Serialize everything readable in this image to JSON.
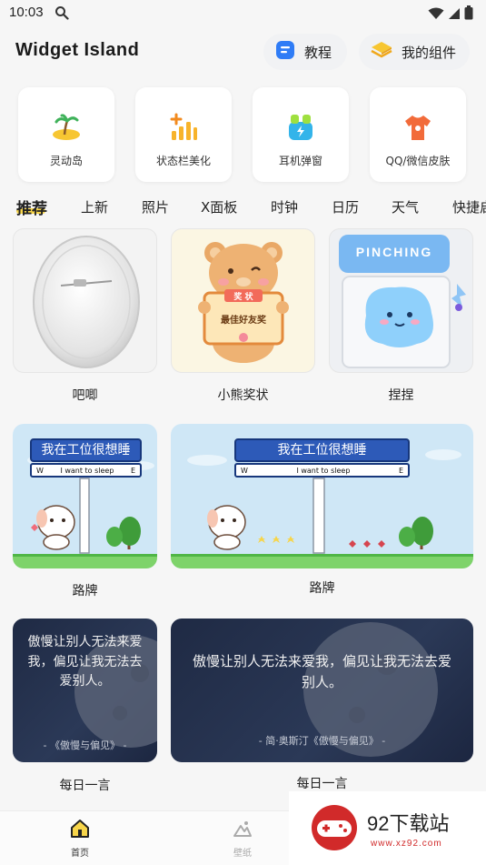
{
  "status": {
    "time": "10:03"
  },
  "header": {
    "title": "Widget Island",
    "tutorial_label": "教程",
    "my_widgets_label": "我的组件"
  },
  "features": [
    {
      "label": "灵动岛",
      "icon": "island-icon"
    },
    {
      "label": "状态栏美化",
      "icon": "signal-bars-icon"
    },
    {
      "label": "耳机弹窗",
      "icon": "earbuds-icon"
    },
    {
      "label": "QQ/微信皮肤",
      "icon": "tshirt-icon"
    }
  ],
  "tabs": [
    "推荐",
    "上新",
    "照片",
    "X面板",
    "时钟",
    "日历",
    "天气",
    "快捷启"
  ],
  "active_tab": "推荐",
  "widgets": {
    "badge": {
      "label": "吧唧"
    },
    "bear": {
      "label": "小熊奖状",
      "banner": "奖 状",
      "text": "最佳好友奖"
    },
    "pinch": {
      "label": "捏捏",
      "brand": "PINCHING"
    },
    "sign_small": {
      "label": "路牌",
      "sign_text": "我在工位很想睡",
      "sub_text": "I want to sleep",
      "west": "W",
      "east": "E"
    },
    "sign_large": {
      "label": "路牌",
      "sign_text": "我在工位很想睡",
      "sub_text": "I want to sleep",
      "west": "W",
      "east": "E"
    },
    "quote_small": {
      "label": "每日一言",
      "text": "傲慢让别人无法来爱我，偏见让我无法去爱别人。",
      "source": "- 《傲慢与偏见》 -"
    },
    "quote_large": {
      "label": "每日一言",
      "text": "傲慢让别人无法来爱我，偏见让我无法去爱别人。",
      "source": "- 简·奥斯汀《傲慢与偏见》 -"
    }
  },
  "bottom_nav": {
    "home": "首页",
    "wallpaper": "壁纸"
  },
  "watermark": {
    "text": "92下载站",
    "url": "www.xz92.com"
  },
  "colors": {
    "accent": "#f7d54a",
    "sign_blue": "#2d5ab8",
    "quote_bg": "#2b3957"
  }
}
